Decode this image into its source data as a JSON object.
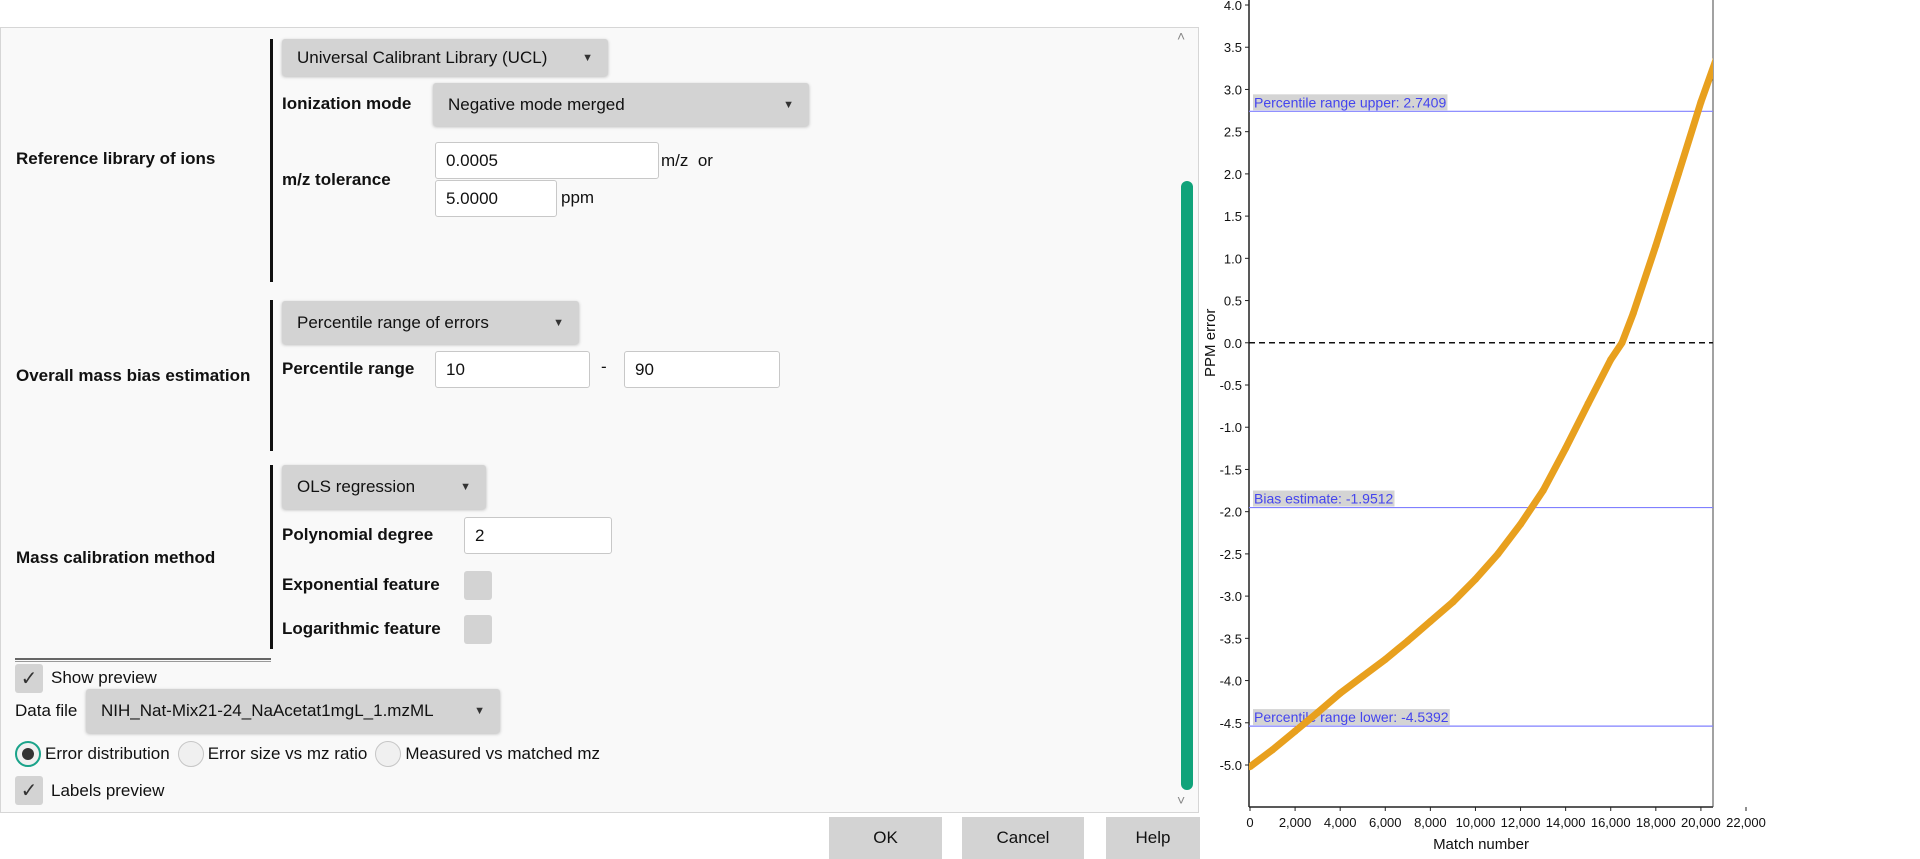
{
  "sections": {
    "reference": {
      "label": "Reference library of ions",
      "library_select": "Universal Calibrant Library (UCL)",
      "ionization_label": "Ionization mode",
      "ionization_select": "Negative mode merged",
      "tolerance_label": "m/z tolerance",
      "mz_value": "0.0005",
      "mz_unit": "m/z  or",
      "ppm_value": "5.0000",
      "ppm_unit": "ppm"
    },
    "bias": {
      "label": "Overall mass bias estimation",
      "method_select": "Percentile range of errors",
      "range_label": "Percentile range",
      "range_low": "10",
      "range_sep": "-",
      "range_high": "90"
    },
    "calibration": {
      "label": "Mass calibration method",
      "method_select": "OLS regression",
      "degree_label": "Polynomial degree",
      "degree_value": "2",
      "exp_label": "Exponential feature",
      "exp_checked": false,
      "log_label": "Logarithmic feature",
      "log_checked": false
    }
  },
  "preview": {
    "show_preview_label": "Show preview",
    "show_preview_checked": true,
    "data_file_label": "Data file",
    "data_file_select": "NIH_Nat-Mix21-24_NaAcetat1mgL_1.mzML",
    "radios": [
      {
        "label": "Error distribution",
        "selected": true
      },
      {
        "label": "Error size vs mz ratio",
        "selected": false
      },
      {
        "label": "Measured vs matched mz",
        "selected": false
      }
    ],
    "labels_preview_label": "Labels preview",
    "labels_preview_checked": true
  },
  "buttons": {
    "ok": "OK",
    "cancel": "Cancel",
    "help": "Help"
  },
  "icons": {
    "dropdown": "caret-down-icon",
    "scroll_up": "chevron-up-icon",
    "scroll_down": "chevron-down-icon",
    "check": "check-icon"
  },
  "colors": {
    "accent": "#10a37a",
    "curve": "#e8a01e",
    "ref_line": "#6b6bff"
  },
  "chart_data": {
    "type": "line",
    "xlabel": "Match number",
    "ylabel": "PPM error",
    "xlim": [
      0,
      22500
    ],
    "ylim": [
      -5.5,
      4.0
    ],
    "x_ticks": [
      "0",
      "2,000",
      "4,000",
      "6,000",
      "8,000",
      "10,000",
      "12,000",
      "14,000",
      "16,000",
      "18,000",
      "20,000",
      "22,000"
    ],
    "y_ticks": [
      "4.0",
      "3.5",
      "3.0",
      "2.5",
      "2.0",
      "1.5",
      "1.0",
      "0.5",
      "0.0",
      "-0.5",
      "-1.0",
      "-1.5",
      "-2.0",
      "-2.5",
      "-3.0",
      "-3.5",
      "-4.0",
      "-4.5",
      "-5.0"
    ],
    "series": [
      {
        "x": [
          0,
          1000,
          2000,
          3000,
          4000,
          5000,
          6000,
          7000,
          8000,
          9000,
          10000,
          11000,
          12000,
          13000,
          14000,
          15000,
          16000,
          16500,
          17000,
          18000,
          19000,
          20000,
          21000,
          21600
        ],
        "y": [
          -5.02,
          -4.82,
          -4.6,
          -4.38,
          -4.15,
          -3.95,
          -3.75,
          -3.53,
          -3.3,
          -3.07,
          -2.8,
          -2.5,
          -2.15,
          -1.75,
          -1.25,
          -0.72,
          -0.2,
          0.0,
          0.35,
          1.15,
          2.0,
          2.85,
          3.6,
          4.1
        ]
      }
    ],
    "zero_line": 0.0,
    "reference_lines": [
      {
        "label": "Percentile range upper: 2.7409",
        "value": 2.7409
      },
      {
        "label": "Bias estimate: -1.9512",
        "value": -1.9512
      },
      {
        "label": "Percentile range lower: -4.5392",
        "value": -4.5392
      }
    ]
  }
}
